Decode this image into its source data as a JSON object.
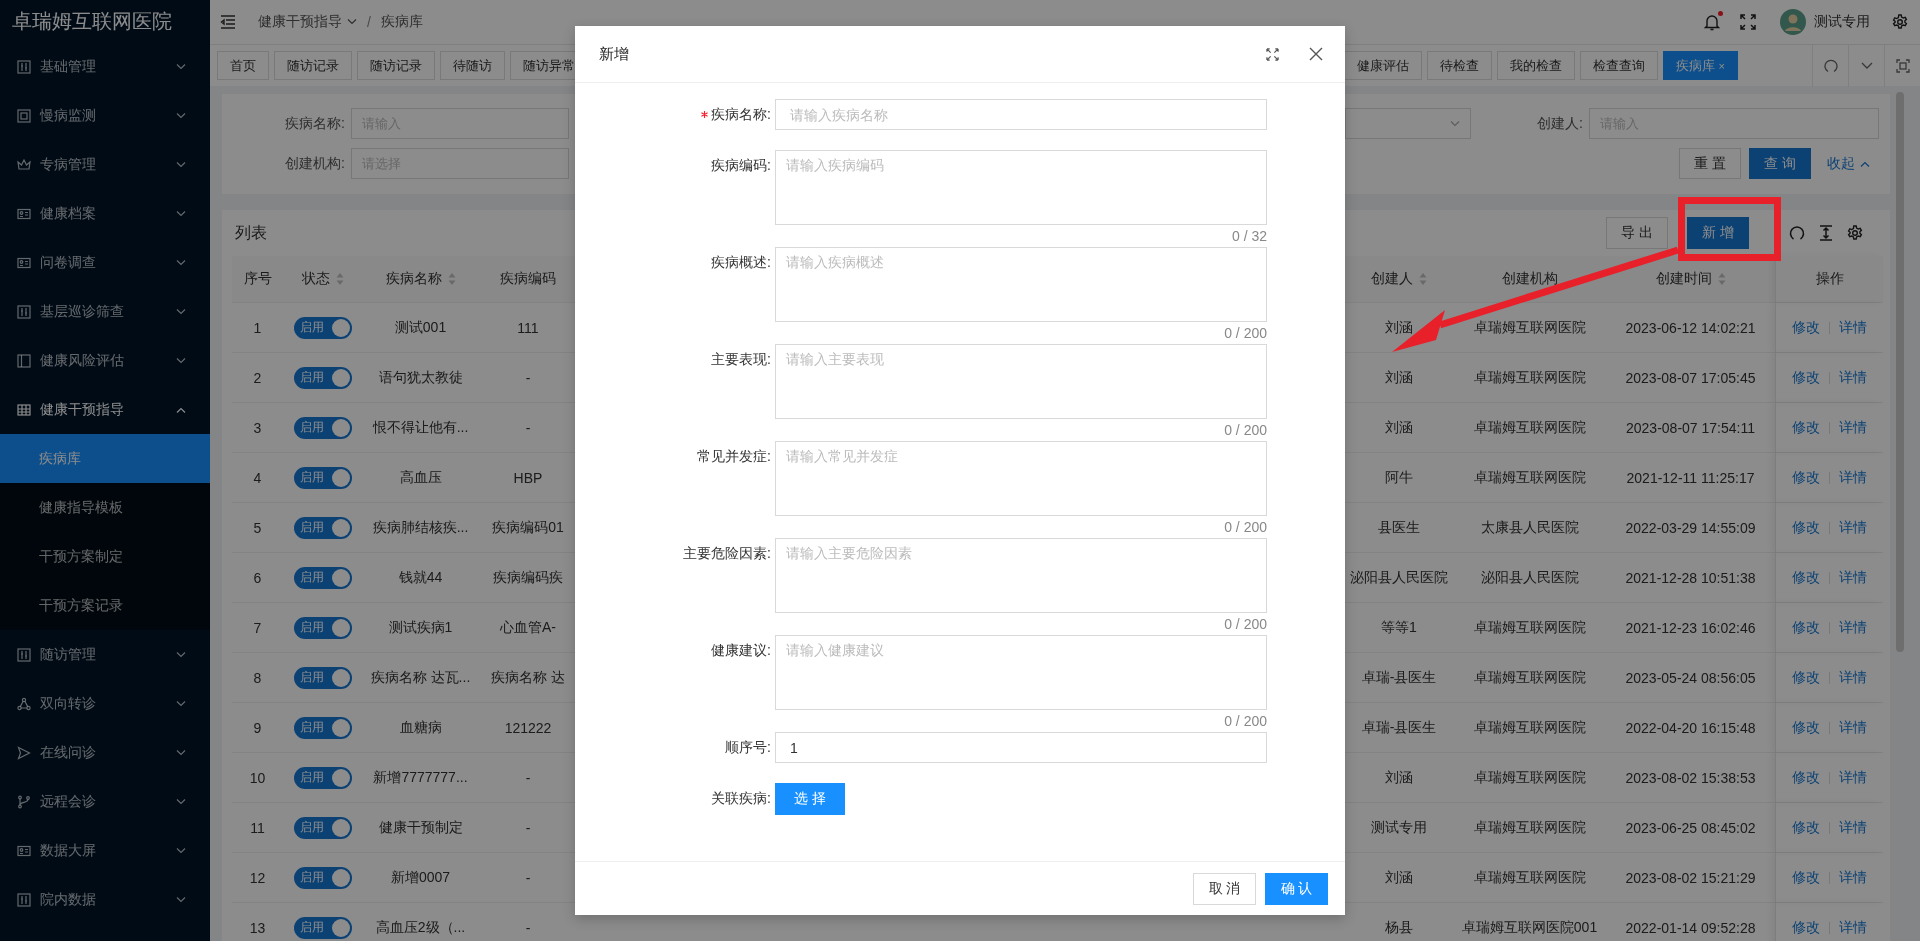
{
  "app_title": "卓瑞姆互联网医院",
  "sidebar": {
    "items": [
      {
        "label": "基础管理",
        "expanded": false
      },
      {
        "label": "慢病监测",
        "expanded": false
      },
      {
        "label": "专病管理",
        "expanded": false
      },
      {
        "label": "健康档案",
        "expanded": false
      },
      {
        "label": "问卷调查",
        "expanded": false
      },
      {
        "label": "基层巡诊筛查",
        "expanded": false
      },
      {
        "label": "健康风险评估",
        "expanded": false
      },
      {
        "label": "健康干预指导",
        "expanded": true,
        "children": [
          {
            "label": "疾病库",
            "selected": true
          },
          {
            "label": "健康指导模板",
            "selected": false
          },
          {
            "label": "干预方案制定",
            "selected": false
          },
          {
            "label": "干预方案记录",
            "selected": false
          }
        ]
      },
      {
        "label": "随访管理",
        "expanded": false
      },
      {
        "label": "双向转诊",
        "expanded": false
      },
      {
        "label": "在线问诊",
        "expanded": false
      },
      {
        "label": "远程会诊",
        "expanded": false
      },
      {
        "label": "数据大屏",
        "expanded": false
      },
      {
        "label": "院内数据",
        "expanded": false
      }
    ]
  },
  "header": {
    "breadcrumb": [
      {
        "label": "健康干预指导",
        "dropdown": true
      },
      {
        "label": "疾病库",
        "dropdown": false
      }
    ],
    "separator": "/",
    "notification_dot": true,
    "user": "测试专用"
  },
  "tab_bar": {
    "left_tabs": [
      {
        "label": "首页",
        "selected": false
      },
      {
        "label": "随访记录",
        "selected": false
      },
      {
        "label": "随访记录",
        "selected": false
      },
      {
        "label": "待随访",
        "selected": false
      },
      {
        "label": "随访异常",
        "selected": false
      }
    ],
    "right_tabs": [
      {
        "label": "健康评估",
        "selected": false
      },
      {
        "label": "待检查",
        "selected": false
      },
      {
        "label": "我的检查",
        "selected": false
      },
      {
        "label": "检查查询",
        "selected": false
      },
      {
        "label": "疾病库",
        "selected": true,
        "close_mark": "×"
      }
    ]
  },
  "search_form": {
    "left_fields": [
      {
        "label": "疾病名称:",
        "placeholder": "请输入"
      },
      {
        "label": "创建机构:",
        "placeholder": "请选择"
      }
    ],
    "creator_field": {
      "label": "创建人:",
      "placeholder": "请输入"
    },
    "buttons": [
      {
        "label": "重 置",
        "primary": false
      },
      {
        "label": "查 询",
        "primary": true
      }
    ],
    "collapse_link": "收起"
  },
  "list": {
    "title": "列表",
    "toolbar": [
      {
        "label": "导 出",
        "primary": false
      },
      {
        "label": "新 增",
        "primary": true
      }
    ],
    "table": {
      "left_columns": [
        {
          "label": "序号",
          "sortable": false
        },
        {
          "label": "状态",
          "sortable": true
        },
        {
          "label": "疾病名称",
          "sortable": true
        },
        {
          "label": "疾病编码",
          "sortable": false
        }
      ],
      "right_columns": [
        {
          "label": "创建人",
          "sortable": true
        },
        {
          "label": "创建机构",
          "sortable": false
        },
        {
          "label": "创建时间",
          "sortable": true
        },
        {
          "label": "操作",
          "sortable": false
        }
      ],
      "rows": [
        {
          "seq": "1",
          "status": {
            "label": "启用",
            "on": true
          },
          "name": "测试001",
          "code": "111",
          "creator": "刘涵",
          "org": "卓瑞姆互联网医院",
          "created": "2023-06-12 14:02:21",
          "actions": [
            "修改",
            "详情"
          ]
        },
        {
          "seq": "2",
          "status": {
            "label": "启用",
            "on": true
          },
          "name": "语句犹太教徒",
          "code": "-",
          "creator": "刘涵",
          "org": "卓瑞姆互联网医院",
          "created": "2023-08-07 17:05:45",
          "actions": [
            "修改",
            "详情"
          ]
        },
        {
          "seq": "3",
          "status": {
            "label": "启用",
            "on": true
          },
          "name": "恨不得让他有...",
          "code": "-",
          "creator": "刘涵",
          "org": "卓瑞姆互联网医院",
          "created": "2023-08-07 17:54:11",
          "actions": [
            "修改",
            "详情"
          ]
        },
        {
          "seq": "4",
          "status": {
            "label": "启用",
            "on": true
          },
          "name": "高血压",
          "code": "HBP",
          "creator": "阿牛",
          "org": "卓瑞姆互联网医院",
          "created": "2021-12-11 11:25:17",
          "actions": [
            "修改",
            "详情"
          ]
        },
        {
          "seq": "5",
          "status": {
            "label": "启用",
            "on": true
          },
          "name": "疾病肺结核疾...",
          "code": "疾病编码01",
          "creator": "县医生",
          "org": "太康县人民医院",
          "created": "2022-03-29 14:55:09",
          "actions": [
            "修改",
            "详情"
          ]
        },
        {
          "seq": "6",
          "status": {
            "label": "启用",
            "on": true
          },
          "name": "钱就44",
          "code": "疾病编码疾",
          "creator": "泌阳县人民医院",
          "org": "泌阳县人民医院",
          "created": "2021-12-28 10:51:38",
          "actions": [
            "修改",
            "详情"
          ]
        },
        {
          "seq": "7",
          "status": {
            "label": "启用",
            "on": true
          },
          "name": "测试疾病1",
          "code": "心血管A-",
          "creator": "等等1",
          "org": "卓瑞姆互联网医院",
          "created": "2021-12-23 16:02:46",
          "actions": [
            "修改",
            "详情"
          ]
        },
        {
          "seq": "8",
          "status": {
            "label": "启用",
            "on": true
          },
          "name": "疾病名称 达瓦...",
          "code": "疾病名称 达",
          "creator": "卓瑞-县医生",
          "org": "卓瑞姆互联网医院",
          "created": "2023-05-24 08:56:05",
          "actions": [
            "修改",
            "详情"
          ]
        },
        {
          "seq": "9",
          "status": {
            "label": "启用",
            "on": true
          },
          "name": "血糖病",
          "code": "121222",
          "creator": "卓瑞-县医生",
          "org": "卓瑞姆互联网医院",
          "created": "2022-04-20 16:15:48",
          "actions": [
            "修改",
            "详情"
          ]
        },
        {
          "seq": "10",
          "status": {
            "label": "启用",
            "on": true
          },
          "name": "新增7777777...",
          "code": "-",
          "creator": "刘涵",
          "org": "卓瑞姆互联网医院",
          "created": "2023-08-02 15:38:53",
          "actions": [
            "修改",
            "详情"
          ]
        },
        {
          "seq": "11",
          "status": {
            "label": "启用",
            "on": true
          },
          "name": "健康干预制定",
          "code": "-",
          "creator": "测试专用",
          "org": "卓瑞姆互联网医院",
          "created": "2023-06-25 08:45:02",
          "actions": [
            "修改",
            "详情"
          ]
        },
        {
          "seq": "12",
          "status": {
            "label": "启用",
            "on": true
          },
          "name": "新增0007",
          "code": "-",
          "creator": "刘涵",
          "org": "卓瑞姆互联网医院",
          "created": "2023-08-02 15:21:29",
          "actions": [
            "修改",
            "详情"
          ]
        },
        {
          "seq": "13",
          "status": {
            "label": "启用",
            "on": true
          },
          "name": "高血压2级（...",
          "code": "-",
          "creator": "杨县",
          "org": "卓瑞姆互联网医院001",
          "created": "2022-01-14 09:52:28",
          "actions": [
            "修改",
            "详情"
          ]
        }
      ]
    }
  },
  "dialog": {
    "title": "新增",
    "fields": [
      {
        "kind": "input",
        "label": "疾病名称:",
        "required": true,
        "placeholder": "请输入疾病名称"
      },
      {
        "kind": "textarea",
        "label": "疾病编码:",
        "required": false,
        "placeholder": "请输入疾病编码",
        "counter": "0 / 32"
      },
      {
        "kind": "textarea",
        "label": "疾病概述:",
        "required": false,
        "placeholder": "请输入疾病概述",
        "counter": "0 / 200"
      },
      {
        "kind": "textarea",
        "label": "主要表现:",
        "required": false,
        "placeholder": "请输入主要表现",
        "counter": "0 / 200"
      },
      {
        "kind": "textarea",
        "label": "常见并发症:",
        "required": false,
        "placeholder": "请输入常见并发症",
        "counter": "0 / 200"
      },
      {
        "kind": "textarea",
        "label": "主要危险因素:",
        "required": false,
        "placeholder": "请输入主要危险因素",
        "counter": "0 / 200"
      },
      {
        "kind": "textarea",
        "label": "健康建议:",
        "required": false,
        "placeholder": "请输入健康建议",
        "counter": "0 / 200"
      },
      {
        "kind": "input",
        "label": "顺序号:",
        "required": false,
        "value": "1"
      },
      {
        "kind": "button",
        "label": "关联疾病:",
        "required": false,
        "button": "选 择"
      }
    ],
    "buttons": [
      {
        "label": "取 消",
        "primary": false
      },
      {
        "label": "确 认",
        "primary": true
      }
    ]
  }
}
